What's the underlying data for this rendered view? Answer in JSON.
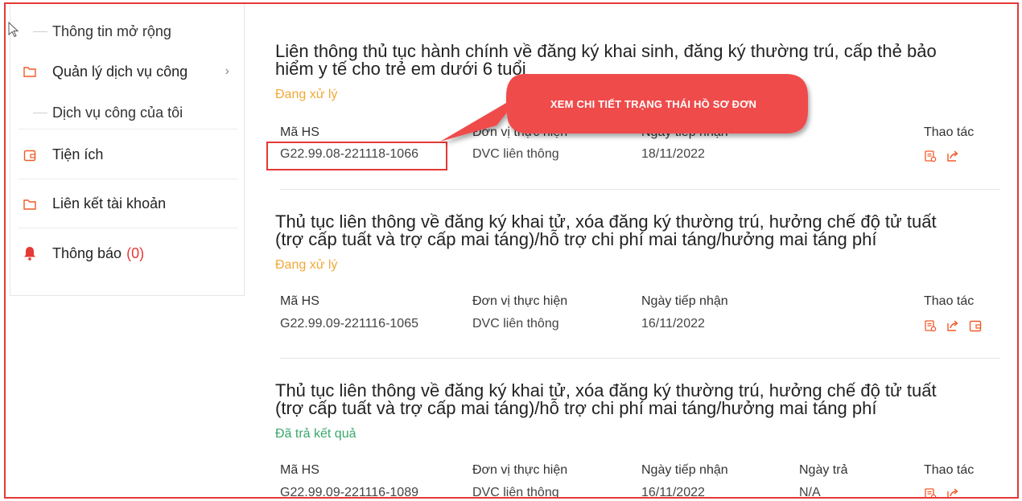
{
  "sidebar": {
    "sub_top": "Thông tin mở rộng",
    "items": [
      {
        "label": "Quản lý dịch vụ công",
        "icon": "folder-icon"
      },
      {
        "label": "Tiện ích",
        "icon": "wallet-icon"
      },
      {
        "label": "Liên kết tài khoản",
        "icon": "folder-icon"
      },
      {
        "label": "Thông báo",
        "badge": "(0)",
        "icon": "bell-icon"
      }
    ],
    "sub_my": "Dịch vụ công của tôi"
  },
  "columns": {
    "code": "Mã HS",
    "unit": "Đơn vị thực hiện",
    "received": "Ngày tiếp nhận",
    "returned": "Ngày trả",
    "actions": "Thao tác"
  },
  "records": [
    {
      "title_line1": "Liên thông thủ tục hành chính về đăng ký khai sinh, đăng ký thường trú, cấp thẻ bảo",
      "title_line2": "hiểm y tế cho trẻ em dưới 6 tuổi",
      "status": "Đang xử lý",
      "code": "G22.99.08-221118-1066",
      "unit": "DVC liên thông",
      "received": "18/11/2022"
    },
    {
      "title_line1": "Thủ tục liên thông về đăng ký khai tử, xóa đăng ký thường trú, hưởng chế độ tử tuất",
      "title_line2": "(trợ cấp tuất và trợ cấp mai táng)/hỗ trợ chi phí mai táng/hưởng mai táng phí",
      "status": "Đang xử lý",
      "code": "G22.99.09-221116-1065",
      "unit": "DVC liên thông",
      "received": "16/11/2022"
    },
    {
      "title_line1": "Thủ tục liên thông về đăng ký khai tử, xóa đăng ký thường trú, hưởng chế độ tử tuất",
      "title_line2": "(trợ cấp tuất và trợ cấp mai táng)/hỗ trợ chi phí mai táng/hưởng mai táng phí",
      "status": "Đã trả kết quả",
      "code": "G22.99.09-221116-1089",
      "unit": "DVC liên thông",
      "received": "16/11/2022",
      "returned": "N/A"
    }
  ],
  "callout": {
    "text": "XEM CHI TIẾT TRẠNG THÁI HỒ SƠ ĐƠN"
  },
  "colors": {
    "accent_red": "#e53935",
    "status_processing": "#f0a93a",
    "status_done": "#3aa86b",
    "icon_orange": "#f05a28"
  }
}
